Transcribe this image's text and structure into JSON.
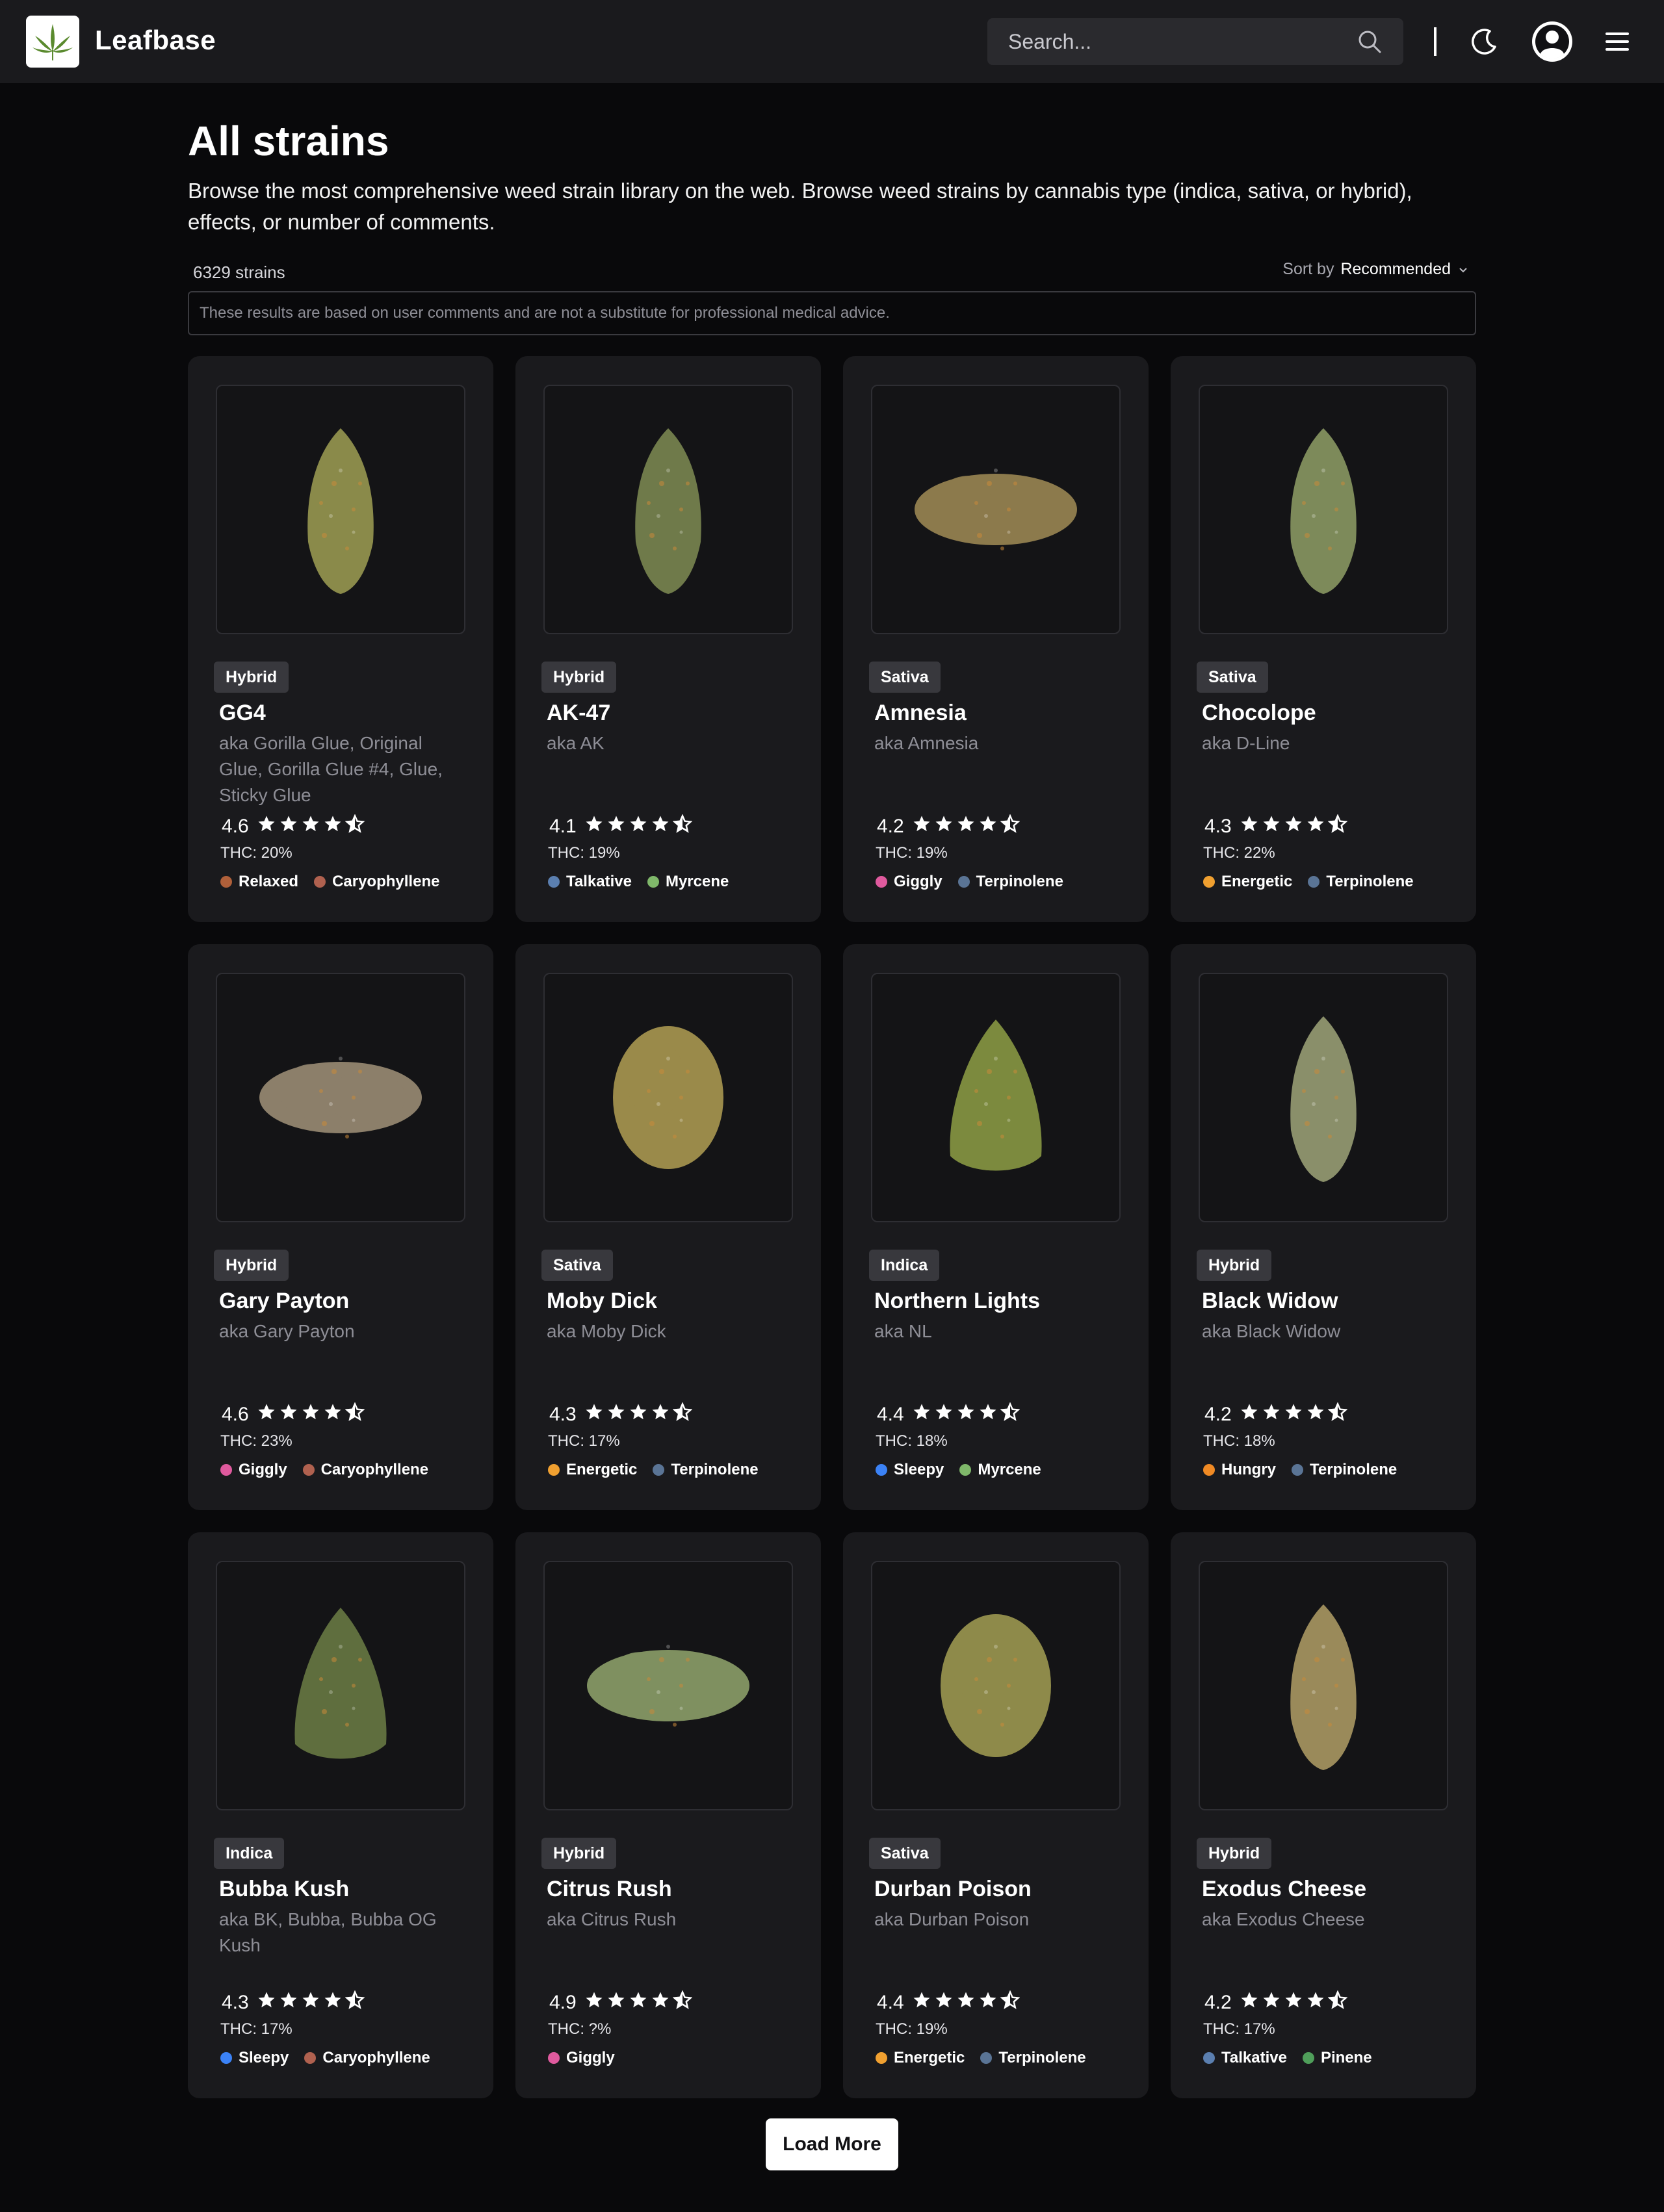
{
  "header": {
    "brand": "Leafbase",
    "search_placeholder": "Search..."
  },
  "page": {
    "title": "All strains",
    "description": "Browse the most comprehensive weed strain library on the web. Browse weed strains by cannabis type (indica, sativa, or hybrid), effects, or number of comments.",
    "count": "6329 strains",
    "sort_label": "Sort by",
    "sort_value": "Recommended",
    "disclaimer": "These results are based on user comments and are not a substitute for professional medical advice."
  },
  "colors": {
    "Relaxed": "#b0603a",
    "Caryophyllene": "#b0614f",
    "Talkative": "#5b7fb0",
    "Myrcene": "#7fb86a",
    "Giggly": "#e05a9e",
    "Terpinolene": "#5a7495",
    "Energetic": "#f0a030",
    "Sleepy": "#3b82f6",
    "Hungry": "#f08a24",
    "Pinene": "#4f9e5a"
  },
  "strains": [
    {
      "type": "Hybrid",
      "name": "GG4",
      "aka": "aka Gorilla Glue, Original Glue, Gorilla Glue #4, Glue, Sticky Glue",
      "rating": "4.6",
      "thc": "THC: 20%",
      "traits": [
        "Relaxed",
        "Caryophyllene"
      ],
      "bud": {
        "shape": "tall",
        "hue": "#8a8a4a"
      }
    },
    {
      "type": "Hybrid",
      "name": "AK-47",
      "aka": "aka AK",
      "rating": "4.1",
      "thc": "THC: 19%",
      "traits": [
        "Talkative",
        "Myrcene"
      ],
      "bud": {
        "shape": "tall",
        "hue": "#6f7a4a"
      }
    },
    {
      "type": "Sativa",
      "name": "Amnesia",
      "aka": "aka Amnesia",
      "rating": "4.2",
      "thc": "THC: 19%",
      "traits": [
        "Giggly",
        "Terpinolene"
      ],
      "bud": {
        "shape": "wide",
        "hue": "#8c7a4c"
      }
    },
    {
      "type": "Sativa",
      "name": "Chocolope",
      "aka": "aka D-Line",
      "rating": "4.3",
      "thc": "THC: 22%",
      "traits": [
        "Energetic",
        "Terpinolene"
      ],
      "bud": {
        "shape": "tall",
        "hue": "#7d8a5a"
      }
    },
    {
      "type": "Hybrid",
      "name": "Gary Payton",
      "aka": "aka Gary Payton",
      "rating": "4.6",
      "thc": "THC: 23%",
      "traits": [
        "Giggly",
        "Caryophyllene"
      ],
      "bud": {
        "shape": "wide",
        "hue": "#8c7f6a"
      }
    },
    {
      "type": "Sativa",
      "name": "Moby Dick",
      "aka": "aka Moby Dick",
      "rating": "4.3",
      "thc": "THC: 17%",
      "traits": [
        "Energetic",
        "Terpinolene"
      ],
      "bud": {
        "shape": "round",
        "hue": "#9a8a4a"
      }
    },
    {
      "type": "Indica",
      "name": "Northern Lights",
      "aka": "aka NL",
      "rating": "4.4",
      "thc": "THC: 18%",
      "traits": [
        "Sleepy",
        "Myrcene"
      ],
      "bud": {
        "shape": "cone",
        "hue": "#7c8a3e"
      }
    },
    {
      "type": "Hybrid",
      "name": "Black Widow",
      "aka": "aka Black Widow",
      "rating": "4.2",
      "thc": "THC: 18%",
      "traits": [
        "Hungry",
        "Terpinolene"
      ],
      "bud": {
        "shape": "tall",
        "hue": "#8a8f6a"
      }
    },
    {
      "type": "Indica",
      "name": "Bubba Kush",
      "aka": "aka BK, Bubba, Bubba OG Kush",
      "rating": "4.3",
      "thc": "THC: 17%",
      "traits": [
        "Sleepy",
        "Caryophyllene"
      ],
      "bud": {
        "shape": "cone",
        "hue": "#5f6e3e"
      }
    },
    {
      "type": "Hybrid",
      "name": "Citrus Rush",
      "aka": "aka Citrus Rush",
      "rating": "4.9",
      "thc": "THC: ?%",
      "traits": [
        "Giggly"
      ],
      "bud": {
        "shape": "wide",
        "hue": "#7f9060"
      }
    },
    {
      "type": "Sativa",
      "name": "Durban Poison",
      "aka": "aka Durban Poison",
      "rating": "4.4",
      "thc": "THC: 19%",
      "traits": [
        "Energetic",
        "Terpinolene"
      ],
      "bud": {
        "shape": "round",
        "hue": "#8e8a4a"
      }
    },
    {
      "type": "Hybrid",
      "name": "Exodus Cheese",
      "aka": "aka Exodus Cheese",
      "rating": "4.2",
      "thc": "THC: 17%",
      "traits": [
        "Talkative",
        "Pinene"
      ],
      "bud": {
        "shape": "tall",
        "hue": "#9a8a5a"
      }
    }
  ],
  "load_more_label": "Load More"
}
